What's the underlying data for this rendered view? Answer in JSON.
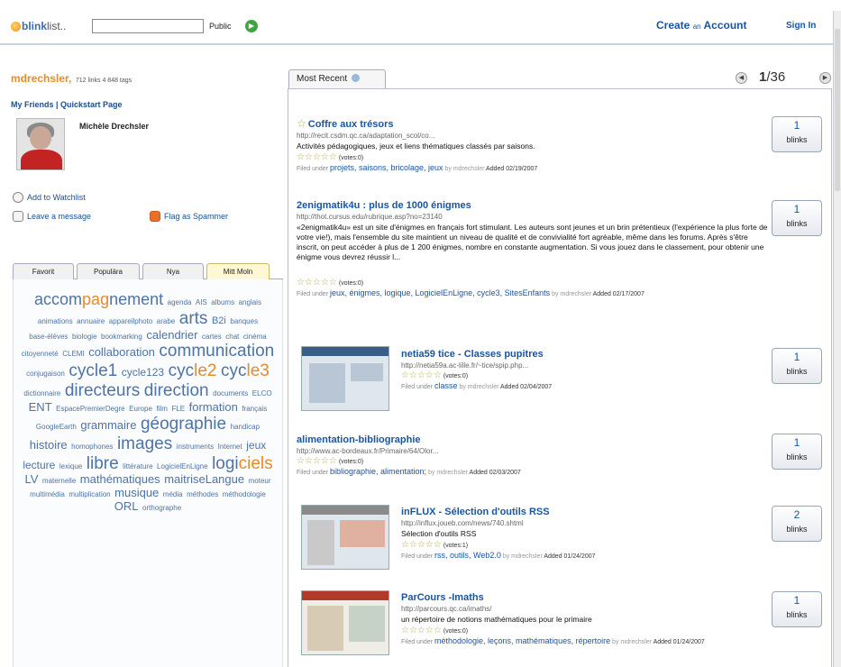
{
  "topbar": {
    "logo_prefix": "blink",
    "logo_suffix": "list..",
    "search_value": "",
    "public_label": "Public",
    "go_icon": "play-circle-icon",
    "create_big1": "Create",
    "create_small": "an",
    "create_big2": "Account",
    "signin": "Sign In"
  },
  "user": {
    "username": "mdrechsler,",
    "stats": "712 links  4 848 tags",
    "friends_links": "My Friends | Quickstart Page",
    "full_name": "Michèle Drechsler",
    "add_watchlist": "Add to Watchlist",
    "leave_message": "Leave a message",
    "flag_spammer": "Flag as Spammer"
  },
  "tag_tabs": [
    "Favorit",
    "Populära",
    "Nya",
    "Mitt Moln"
  ],
  "tag_cloud": [
    {
      "t": "accompagnement",
      "s": 18,
      "c": "mix"
    },
    {
      "t": "agenda",
      "s": 8
    },
    {
      "t": "AIS",
      "s": 8
    },
    {
      "t": "albums",
      "s": 8
    },
    {
      "t": "anglais",
      "s": 8
    },
    {
      "t": "animations",
      "s": 8
    },
    {
      "t": "annuaire",
      "s": 8
    },
    {
      "t": "appareilphoto",
      "s": 8
    },
    {
      "t": "arabe",
      "s": 8
    },
    {
      "t": "arts",
      "s": 19
    },
    {
      "t": "B2i",
      "s": 11
    },
    {
      "t": "banques",
      "s": 8
    },
    {
      "t": "base-élèves",
      "s": 8
    },
    {
      "t": "biologie",
      "s": 8
    },
    {
      "t": "bookmarking",
      "s": 8
    },
    {
      "t": "calendrier",
      "s": 13
    },
    {
      "t": "cartes",
      "s": 8
    },
    {
      "t": "chat",
      "s": 8
    },
    {
      "t": "cinéma",
      "s": 8
    },
    {
      "t": "citoyenneté",
      "s": 8
    },
    {
      "t": "CLEMI",
      "s": 8
    },
    {
      "t": "collaboration",
      "s": 13
    },
    {
      "t": "communication",
      "s": 19
    },
    {
      "t": "conjugaison",
      "s": 8
    },
    {
      "t": "cycle1",
      "s": 19
    },
    {
      "t": "cycle123",
      "s": 12
    },
    {
      "t": "cycle2",
      "s": 19,
      "c": "mix2"
    },
    {
      "t": "cycle3",
      "s": 19,
      "c": "mix3"
    },
    {
      "t": "dictionnaire",
      "s": 8
    },
    {
      "t": "directeurs",
      "s": 19
    },
    {
      "t": "direction",
      "s": 19
    },
    {
      "t": "documents",
      "s": 8
    },
    {
      "t": "ELCO",
      "s": 8
    },
    {
      "t": "ENT",
      "s": 13
    },
    {
      "t": "EspacePremierDegre",
      "s": 8
    },
    {
      "t": "Europe",
      "s": 8
    },
    {
      "t": "film",
      "s": 8
    },
    {
      "t": "FLE",
      "s": 8
    },
    {
      "t": "formation",
      "s": 13
    },
    {
      "t": "français",
      "s": 8
    },
    {
      "t": "GoogleEarth",
      "s": 8
    },
    {
      "t": "grammaire",
      "s": 13
    },
    {
      "t": "géographie",
      "s": 19
    },
    {
      "t": "handicap",
      "s": 8
    },
    {
      "t": "histoire",
      "s": 13
    },
    {
      "t": "homophones",
      "s": 8
    },
    {
      "t": "images",
      "s": 19
    },
    {
      "t": "instruments",
      "s": 8
    },
    {
      "t": "Internet",
      "s": 8
    },
    {
      "t": "jeux",
      "s": 12
    },
    {
      "t": "lecture",
      "s": 12
    },
    {
      "t": "lexique",
      "s": 8
    },
    {
      "t": "libre",
      "s": 19
    },
    {
      "t": "littérature",
      "s": 8
    },
    {
      "t": "LogicielEnLigne",
      "s": 8
    },
    {
      "t": "logiciels",
      "s": 19,
      "c": "mix4"
    },
    {
      "t": "LV",
      "s": 13
    },
    {
      "t": "maternelle",
      "s": 8
    },
    {
      "t": "mathématiques",
      "s": 13
    },
    {
      "t": "maitriseLangue",
      "s": 13
    },
    {
      "t": "moteur",
      "s": 8
    },
    {
      "t": "multimédia",
      "s": 8
    },
    {
      "t": "multiplication",
      "s": 8
    },
    {
      "t": "musique",
      "s": 13
    },
    {
      "t": "média",
      "s": 8
    },
    {
      "t": "méthodes",
      "s": 8
    },
    {
      "t": "méthodologie",
      "s": 8
    },
    {
      "t": "ORL",
      "s": 13
    },
    {
      "t": "orthographe",
      "s": 8
    }
  ],
  "main": {
    "tab_label": "Most Recent",
    "pager_current": "1",
    "pager_total": "/36",
    "items": [
      {
        "title": "Coffre aux trésors",
        "url": "http://recit.csdm.qc.ca/adaptation_scol/co...",
        "desc": "Activités pédagogiques, jeux et liens thématiques classés par saisons.",
        "votes": "(votes:0)",
        "filed_label": "Filed under",
        "tags": "projets, saisons, bricolage, jeux",
        "by": "by mdrechsler",
        "date": "Added 02/19/2007",
        "count": "1",
        "blinks": "blinks"
      },
      {
        "title": "2enigmatik4u : plus de 1000 énigmes",
        "url": "http://thot.cursus.edu/rubrique.asp?no=23140",
        "desc": "«2enigmatik4u» est un site d'énigmes en français fort stimulant. Les auteurs sont jeunes et un brin prétentieux (l'expérience la plus forte de votre vie!), mais l'ensemble du site maintient un niveau de qualité et de convivialité fort agréable, même dans les forums. Après s'être inscrit, on peut accéder à plus de 1 200 énigmes, nombre en constante augmentation. Si vous jouez dans le classement, pour obtenir une énigme vous devrez réussir l...",
        "votes": "(votes:0)",
        "filed_label": "Filed under",
        "tags": "jeux, énigmes, logique, LogicielEnLigne, cycle3, SitesEnfants",
        "by": "by mdrechsler",
        "date": "Added 02/17/2007",
        "count": "1",
        "blinks": "blinks"
      },
      {
        "title": "netia59 tice - Classes pupitres",
        "url": "http://netia59a.ac-lille.fr/~tice/spip.php...",
        "desc": "",
        "votes": "(votes:0)",
        "filed_label": "Filed under",
        "tags": "classe",
        "by": "by mdrechsler",
        "date": "Added 02/04/2007",
        "count": "1",
        "blinks": "blinks"
      },
      {
        "title": "alimentation-bibliographie",
        "url": "http://www.ac-bordeaux.fr/Primaire/64/Olor...",
        "desc": "",
        "votes": "(votes:0)",
        "filed_label": "Filed under",
        "tags": "bibliographie, alimentation;",
        "by": "by mdrechsler",
        "date": "Added 02/03/2007",
        "count": "1",
        "blinks": "blinks"
      },
      {
        "title": "inFLUX - Sélection d'outils RSS",
        "url": "http://influx.joueb.com/news/740.shtml",
        "desc": "Sélection d'outils RSS",
        "votes": "(votes:1)",
        "filed_label": "Filed under",
        "tags": "rss, outils, Web2.0",
        "by": "by mdrechsler",
        "date": "Added 01/24/2007",
        "count": "2",
        "blinks": "blinks"
      },
      {
        "title": "ParCours -Imaths",
        "url": "http://parcours.qc.ca/imaths/",
        "desc": "un répertoire de notions mathématiques pour le primaire",
        "votes": "(votes:0)",
        "filed_label": "Filed under",
        "tags": "méthodologie, leçons, mathématiques, répertoire",
        "by": "by mdrechsler",
        "date": "Added 01/24/2007",
        "count": "1",
        "blinks": "blinks"
      }
    ]
  },
  "stars_glyph": "☆☆☆☆☆"
}
